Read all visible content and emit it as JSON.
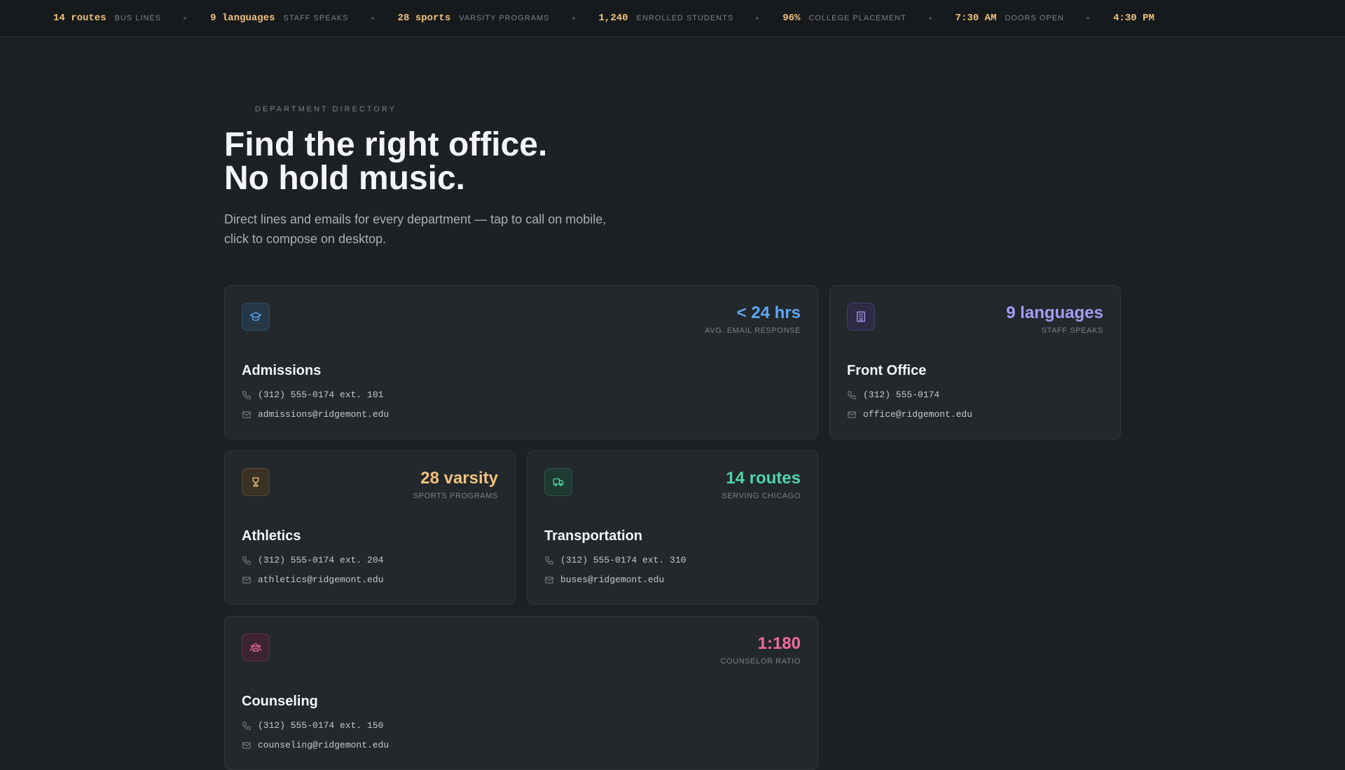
{
  "ticker": [
    {
      "value": "14 routes",
      "label": "Bus lines"
    },
    {
      "value": "9 languages",
      "label": "Staff speaks"
    },
    {
      "value": "28 sports",
      "label": "Varsity programs"
    },
    {
      "value": "1,240",
      "label": "Enrolled students"
    },
    {
      "value": "96%",
      "label": "College placement"
    },
    {
      "value": "7:30 AM",
      "label": "Doors open"
    },
    {
      "value": "4:30 PM",
      "label": ""
    }
  ],
  "hero": {
    "eyebrow": "Department Directory",
    "headline_line1": "Find the right office.",
    "headline_line2": "No hold music.",
    "subtitle": "Direct lines and emails for every department — tap to call on mobile, click to compose on desktop."
  },
  "departments": [
    {
      "name": "Admissions",
      "stat_value": "< 24 hrs",
      "stat_label": "Avg. email response",
      "phone": "(312) 555-0174 ext. 101",
      "email": "admissions@ridgemont.edu",
      "icon": "graduation-cap-icon",
      "accent": "#5fa8f5"
    },
    {
      "name": "Front Office",
      "stat_value": "9 languages",
      "stat_label": "Staff speaks",
      "phone": "(312) 555-0174",
      "email": "office@ridgemont.edu",
      "icon": "building-icon",
      "accent": "#a79af5"
    },
    {
      "name": "Athletics",
      "stat_value": "28 varsity",
      "stat_label": "Sports programs",
      "phone": "(312) 555-0174 ext. 204",
      "email": "athletics@ridgemont.edu",
      "icon": "trophy-icon",
      "accent": "#f1c27d"
    },
    {
      "name": "Transportation",
      "stat_value": "14 routes",
      "stat_label": "Serving Chicago",
      "phone": "(312) 555-0174 ext. 310",
      "email": "buses@ridgemont.edu",
      "icon": "bus-icon",
      "accent": "#4fd6a8"
    },
    {
      "name": "Counseling",
      "stat_value": "1:180",
      "stat_label": "Counselor ratio",
      "phone": "(312) 555-0174 ext. 150",
      "email": "counseling@ridgemont.edu",
      "icon": "people-icon",
      "accent": "#f06c9b"
    }
  ]
}
